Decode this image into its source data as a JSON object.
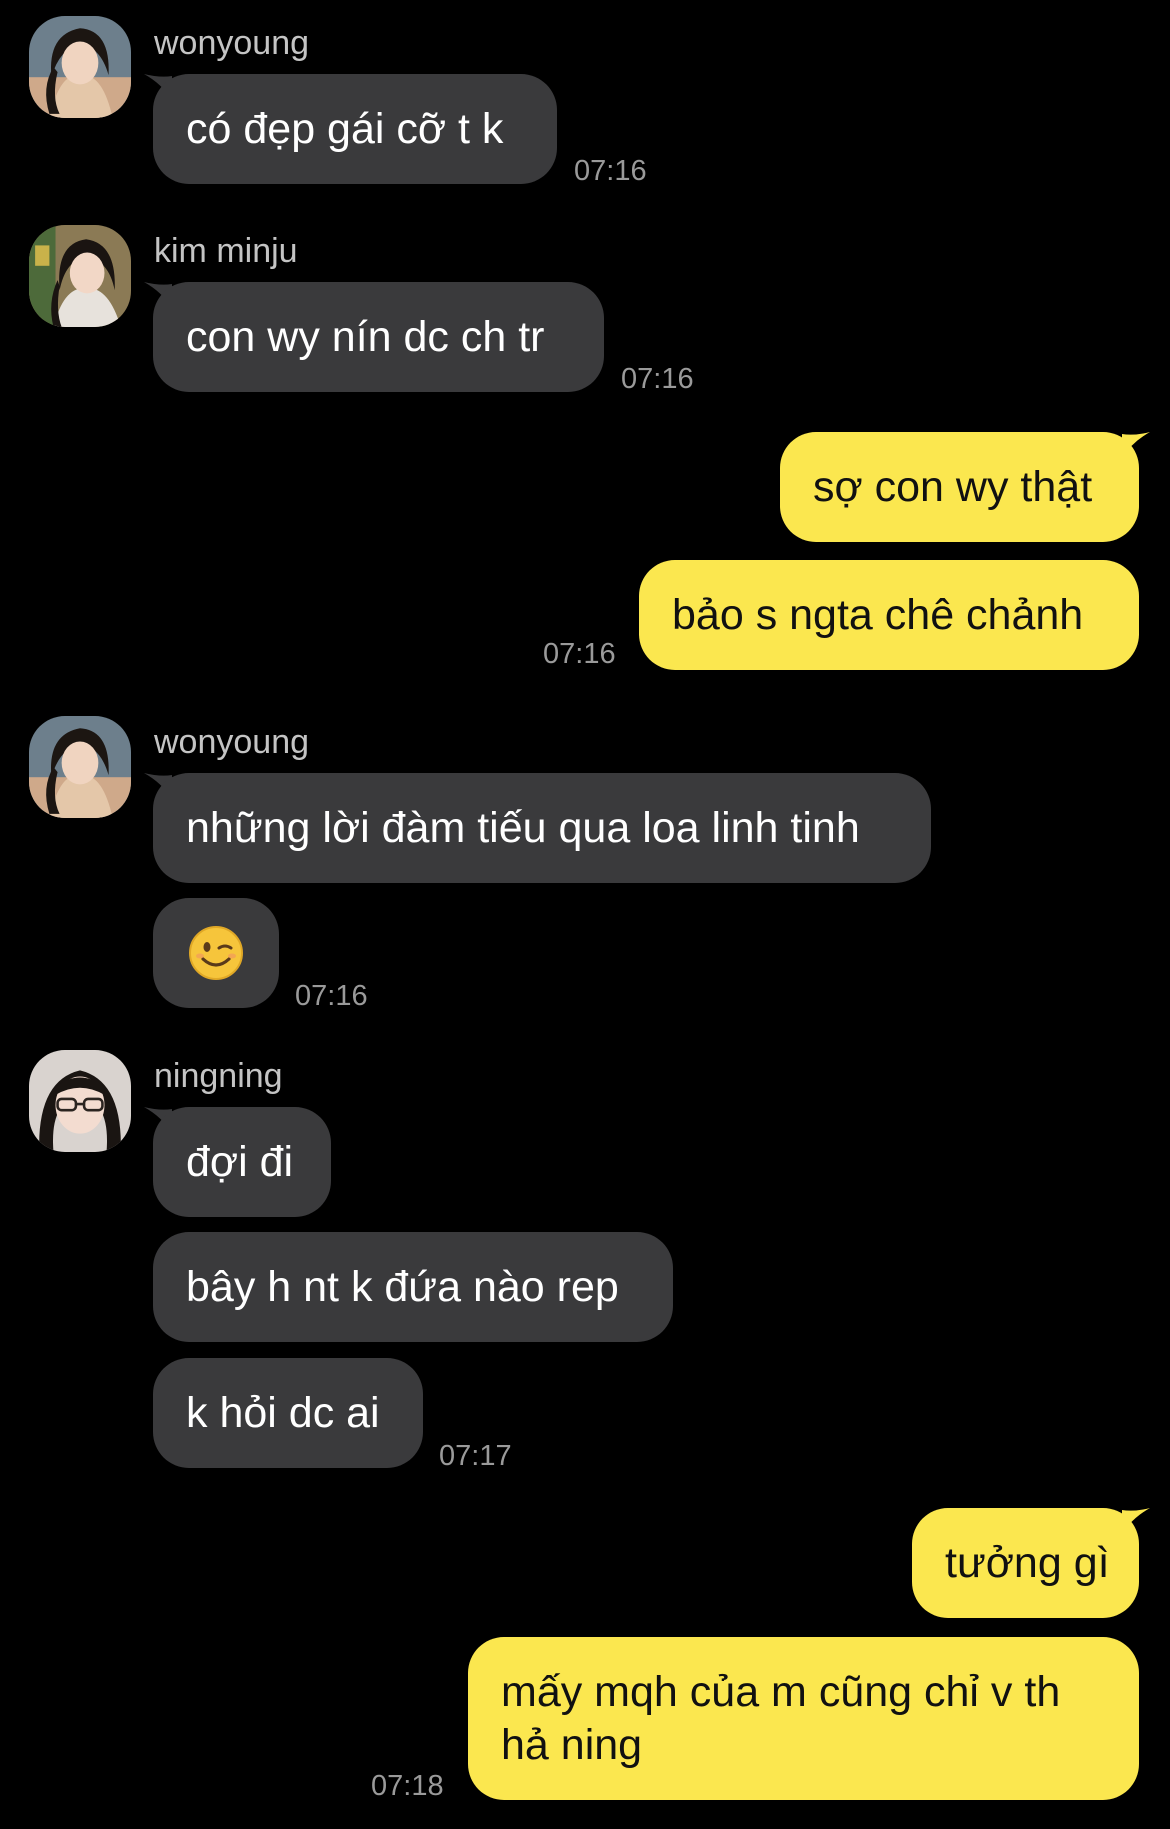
{
  "colors": {
    "background": "#000000",
    "incoming_bubble": "#3a3a3c",
    "outgoing_bubble": "#fbe74f",
    "sender_name": "#c4c4c4",
    "timestamp": "#9a9a9a"
  },
  "messages": [
    {
      "sender": "wonyoung",
      "text": "có đẹp gái cỡ t k",
      "time": "07:16"
    },
    {
      "sender": "kim minju",
      "text": "con wy nín dc ch tr",
      "time": "07:16"
    },
    {
      "me_1": "sợ con wy thật",
      "me_2": "bảo s ngta chê chảnh",
      "time": "07:16"
    },
    {
      "sender": "wonyoung",
      "text_1": "những lời đàm tiếu qua loa linh tinh",
      "emoji": "winking-face",
      "time": "07:16"
    },
    {
      "sender": "ningning",
      "text_1": "đợi đi",
      "text_2": "bây h nt k đứa nào rep",
      "text_3": "k hỏi dc ai",
      "time": "07:17"
    },
    {
      "me_1": "tưởng gì",
      "me_2": "mấy mqh của m cũng chỉ v th hả ning",
      "time": "07:18"
    }
  ]
}
